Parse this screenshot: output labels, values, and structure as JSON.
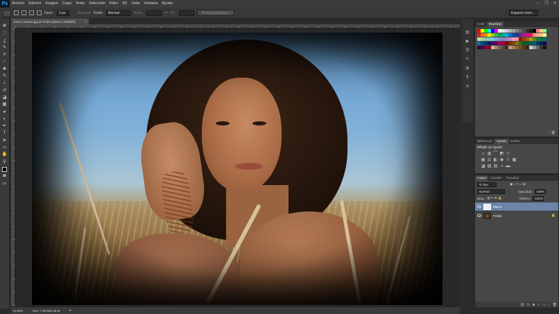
{
  "menu": {
    "logo": "Ps",
    "items": [
      "Archivo",
      "Edición",
      "Imagen",
      "Capa",
      "Texto",
      "Selección",
      "Filtro",
      "3D",
      "Vista",
      "Ventana",
      "Ayuda"
    ]
  },
  "options_bar": {
    "feather_label": "Desv.:",
    "feather_value": "0 px",
    "smooth_label": "Suavizar",
    "style_label": "Estilo:",
    "style_value": "Normal",
    "width_label": "Anch.:",
    "height_label": "Alt.:",
    "refine_button": "Perfeccionar bor...",
    "workspace": "Espacio esen..."
  },
  "tools": [
    "move-tool",
    "marquee-tool",
    "lasso-tool",
    "quick-select-tool",
    "crop-tool",
    "eyedropper-tool",
    "healing-tool",
    "brush-tool",
    "clone-tool",
    "history-brush-tool",
    "eraser-tool",
    "gradient-tool",
    "blur-tool",
    "dodge-tool",
    "pen-tool",
    "type-tool",
    "path-select-tool",
    "shape-tool",
    "hand-tool",
    "zoom-tool"
  ],
  "tool_glyphs": [
    "✥",
    "⬚",
    "ʆ",
    "✎",
    "⌗",
    "⁄",
    "✚",
    "✎",
    "⊥",
    "↺",
    "◪",
    "▦",
    "●",
    "◐",
    "✒",
    "T",
    "➤",
    "▭",
    "✋",
    "⚲"
  ],
  "document": {
    "tab_title": "Joven morena.jpg al 73,9% (Marco, RGB/8#)",
    "close": "×"
  },
  "status": {
    "zoom": "73,95%",
    "doc_info": "Doc: 7,93 M/5,36 M"
  },
  "panels": {
    "color_tabs": [
      "Color",
      "Muestras"
    ],
    "adjust_tabs": [
      "Bibliotecas",
      "Ajustes",
      "Estilos"
    ],
    "adjust_title": "Añadir un ajuste",
    "layer_tabs": [
      "Capas",
      "Canales",
      "Trazados"
    ],
    "layer_kind": "Tipo",
    "blend_mode": "Normal",
    "opacity_label": "Opacidad:",
    "opacity_value": "100%",
    "lock_label": "Bloq.:",
    "fill_label": "Relleno:",
    "fill_value": "100%",
    "layers": [
      {
        "name": "Marco",
        "selected": true
      },
      {
        "name": "Fondo",
        "selected": false
      }
    ]
  },
  "colors": {
    "accent_selected_layer": "#6b84a8",
    "app_bg": "#2b2b2b"
  }
}
